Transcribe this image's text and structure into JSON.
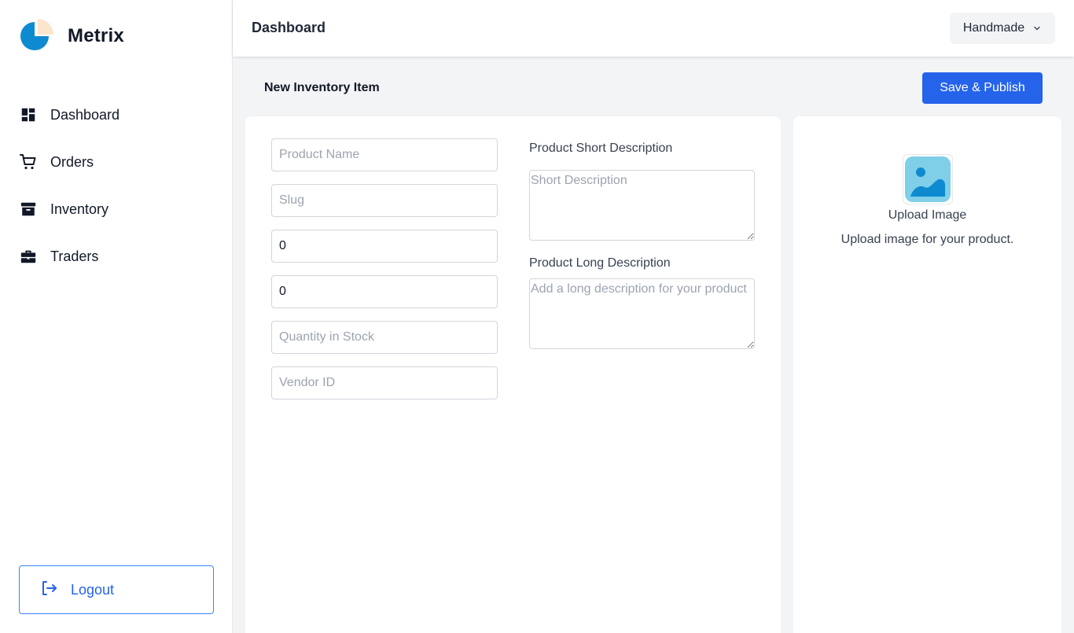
{
  "brand": {
    "name": "Metrix",
    "logo_icon": "pie-chart-logo"
  },
  "sidebar": {
    "items": [
      {
        "label": "Dashboard",
        "icon": "dashboard-icon"
      },
      {
        "label": "Orders",
        "icon": "cart-icon"
      },
      {
        "label": "Inventory",
        "icon": "archive-icon"
      },
      {
        "label": "Traders",
        "icon": "briefcase-icon"
      }
    ],
    "logout_label": "Logout"
  },
  "header": {
    "title": "Dashboard",
    "store_select": {
      "value": "Handmade"
    }
  },
  "toolbar": {
    "title": "New Inventory Item",
    "save_label": "Save & Publish"
  },
  "form": {
    "product_name": {
      "placeholder": "Product Name",
      "value": ""
    },
    "slug": {
      "placeholder": "Slug",
      "value": ""
    },
    "price": {
      "value": "0"
    },
    "sale_price": {
      "value": "0"
    },
    "quantity": {
      "placeholder": "Quantity in Stock",
      "value": ""
    },
    "vendor_id": {
      "placeholder": "Vendor ID",
      "value": ""
    },
    "short_desc": {
      "label": "Product Short Description",
      "placeholder": "Short Description"
    },
    "long_desc": {
      "label": "Product Long Description",
      "placeholder": "Add a long description for your product"
    }
  },
  "upload": {
    "label": "Upload Image",
    "help": "Upload image for your product."
  },
  "colors": {
    "accent": "#2563eb",
    "logo_blue": "#0e8bd0",
    "logo_peach": "#fbe5cc"
  }
}
